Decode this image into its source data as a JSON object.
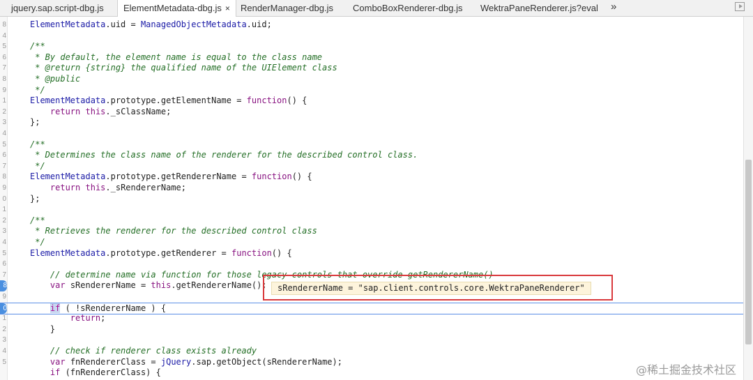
{
  "tabs": [
    {
      "label": "jquery.sap.script-dbg.js",
      "active": false
    },
    {
      "label": "ElementMetadata-dbg.js",
      "active": true,
      "close": "×"
    },
    {
      "label": "RenderManager-dbg.js",
      "active": false
    },
    {
      "label": "ComboBoxRenderer-dbg.js",
      "active": false
    },
    {
      "label": "WektraPaneRenderer.js?eval",
      "active": false
    }
  ],
  "tab_overflow": "»",
  "gutter": [
    "8",
    "4",
    "5",
    "6",
    "7",
    "8",
    "9",
    "1",
    "2",
    "3",
    "4",
    "5",
    "6",
    "7",
    "8",
    "9",
    "0",
    "1",
    "2",
    "3",
    "4",
    "5",
    "6",
    "7",
    "8",
    "9",
    "0",
    "1",
    "2",
    "3",
    "4",
    "5"
  ],
  "code_lines": [
    "ElementMetadata.uid = ManagedObjectMetadata.uid;",
    "",
    "/**",
    " * By default, the element name is equal to the class name",
    " * @return {string} the qualified name of the UIElement class",
    " * @public",
    " */",
    "ElementMetadata.prototype.getElementName = function() {",
    "    return this._sClassName;",
    "};",
    "",
    "/**",
    " * Determines the class name of the renderer for the described control class.",
    " */",
    "ElementMetadata.prototype.getRendererName = function() {",
    "    return this._sRendererName;",
    "};",
    "",
    "/**",
    " * Retrieves the renderer for the described control class",
    " */",
    "ElementMetadata.prototype.getRenderer = function() {",
    "",
    "    // determine name via function for those legacy controls that override getRendererName()",
    "    var sRendererName = this.getRendererName();",
    "",
    "    if ( !sRendererName ) {",
    "        return;",
    "    }",
    "",
    "    // check if renderer class exists already",
    "    var fnRendererClass = jQuery.sap.getObject(sRendererName);",
    "    if (fnRendererClass) {"
  ],
  "tooltip": "sRendererName = \"sap.client.controls.core.WektraPaneRenderer\"",
  "watermark": "@稀土掘金技术社区"
}
